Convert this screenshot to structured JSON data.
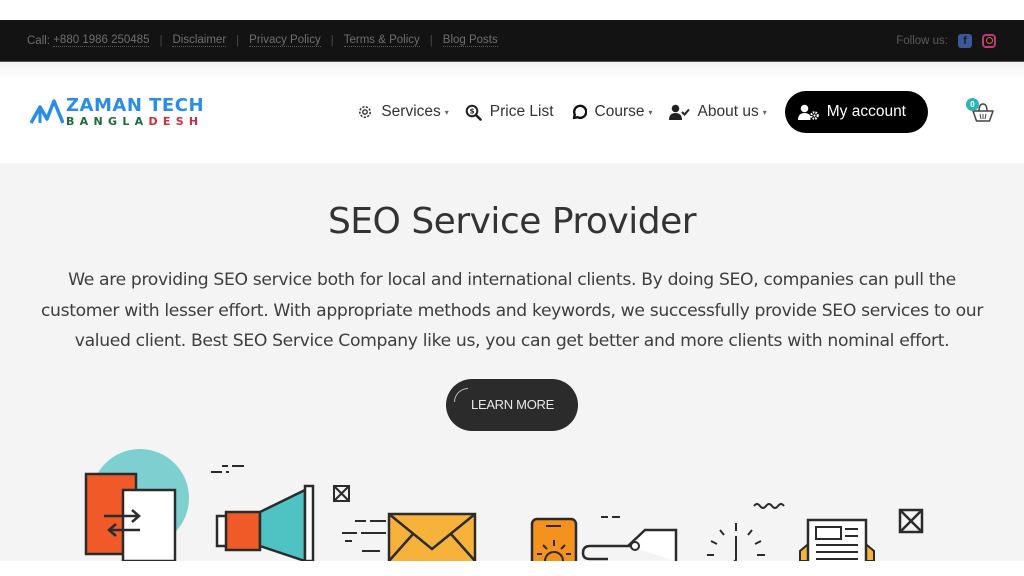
{
  "topbar": {
    "call_label": "Call:",
    "phone": "+880 1986 250485",
    "links": [
      "Disclaimer",
      "Privacy Policy",
      "Terms & Policy",
      "Blog Posts"
    ],
    "follow_label": "Follow us:",
    "social": [
      {
        "name": "facebook-icon",
        "color": "#3b5998"
      },
      {
        "name": "instagram-icon",
        "color": "#c13584"
      }
    ]
  },
  "header": {
    "logo_top": "ZAMAN TECH",
    "logo_bottom_green": "BANGLA",
    "logo_bottom_red": "DESH",
    "nav": [
      {
        "label": "Services",
        "icon": "gear-icon",
        "dropdown": true
      },
      {
        "label": "Price List",
        "icon": "search-dollar-icon",
        "dropdown": false
      },
      {
        "label": "Course",
        "icon": "chat-bubble-icon",
        "dropdown": true
      },
      {
        "label": "About us",
        "icon": "user-check-icon",
        "dropdown": true
      }
    ],
    "account_label": "My account",
    "cart_count": "0"
  },
  "hero": {
    "title": "SEO Service Provider",
    "text": "We are providing SEO service both for local and international clients. By doing SEO, companies can pull the customer with lesser effort. With appropriate methods and keywords, we successfully provide SEO services to our valued client. Best SEO Service Company like us, you can get better and more clients with nominal effort.",
    "button_label": "LEARN MORE"
  },
  "colors": {
    "topbar_bg": "#131313",
    "brand_blue": "#2a8ee8",
    "brand_green": "#1d6b3a",
    "brand_red": "#d42a3a",
    "hero_bg": "#f4f4f4",
    "accent_teal": "#4fc3c3",
    "accent_orange": "#f05a28",
    "accent_yellow": "#f7b23b"
  }
}
